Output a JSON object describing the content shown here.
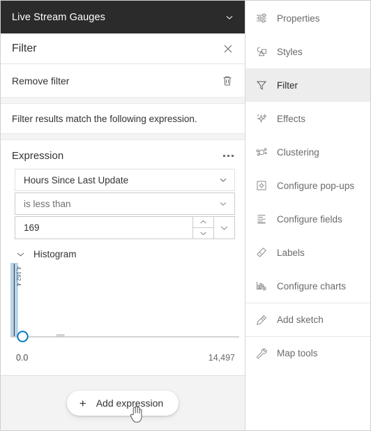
{
  "layer": {
    "title": "Live Stream Gauges",
    "collapse_icon": "chevron-down-icon"
  },
  "panel": {
    "title": "Filter",
    "close_icon": "close-icon",
    "remove_filter_label": "Remove filter",
    "remove_filter_icon": "trash-icon",
    "match_text": "Filter results match the following expression."
  },
  "expression": {
    "title": "Expression",
    "menu_icon": "kebab-menu-icon",
    "field_value": "Hours Since Last Update",
    "operator_value": "is less than",
    "number_value": "169",
    "caret_icon": "chevron-down-icon",
    "spinner_up_icon": "chevron-up-icon",
    "spinner_down_icon": "chevron-down-icon"
  },
  "histogram": {
    "label": "Histogram",
    "toggle_icon": "chevron-down-icon",
    "axis_min": "0.0",
    "axis_max": "14,497",
    "bar_value_label": "4,162.4",
    "handle_icon": "slider-handle"
  },
  "footer": {
    "add_expression_label": "Add expression",
    "plus_icon": "plus-icon",
    "cursor_icon": "pointer-hand-cursor"
  },
  "sidebar": {
    "items": [
      {
        "label": "Properties",
        "icon": "sliders-icon",
        "active": false,
        "divider_above": false
      },
      {
        "label": "Styles",
        "icon": "shapes-icon",
        "active": false,
        "divider_above": false
      },
      {
        "label": "Filter",
        "icon": "funnel-icon",
        "active": true,
        "divider_above": false
      },
      {
        "label": "Effects",
        "icon": "sparkles-icon",
        "active": false,
        "divider_above": false
      },
      {
        "label": "Clustering",
        "icon": "clustering-icon",
        "active": false,
        "divider_above": false
      },
      {
        "label": "Configure pop-ups",
        "icon": "popup-icon",
        "active": false,
        "divider_above": false
      },
      {
        "label": "Configure fields",
        "icon": "fields-list-icon",
        "active": false,
        "divider_above": false
      },
      {
        "label": "Labels",
        "icon": "label-tag-icon",
        "active": false,
        "divider_above": false
      },
      {
        "label": "Configure charts",
        "icon": "bar-chart-gear-icon",
        "active": false,
        "divider_above": false
      },
      {
        "label": "Add sketch",
        "icon": "pencil-sketch-icon",
        "active": false,
        "divider_above": true
      },
      {
        "label": "Map tools",
        "icon": "wrench-icon",
        "active": false,
        "divider_above": true
      }
    ]
  },
  "chart_data": {
    "type": "bar",
    "title": "Histogram",
    "xlabel": "",
    "ylabel": "",
    "xlim": [
      0,
      14497
    ],
    "bin_count": 20,
    "bins": [
      0,
      724.85,
      1449.7,
      2174.55,
      2899.4,
      3624.25,
      4349.1,
      5073.95,
      5798.8,
      6523.65,
      7248.5,
      7973.35,
      8698.2,
      9423.05,
      10147.9,
      10872.75,
      11597.6,
      12322.45,
      13047.3,
      13772.15
    ],
    "values": [
      4162.4,
      0,
      0,
      12,
      0,
      0,
      0,
      0,
      0,
      0,
      0,
      0,
      0,
      0,
      0,
      0,
      0,
      0,
      0,
      0
    ],
    "max_value": 4162.4,
    "bar_color": "#b7d5ea",
    "tick_labels": [
      "0.0",
      "14,497"
    ],
    "slider_handle_position": 0,
    "threshold_value": 169,
    "grid": false,
    "legend": null
  },
  "colors": {
    "header_bg": "#2b2b2b",
    "accent_blue": "#0079c1",
    "bar_fill": "#b7d5ea",
    "panel_bg": "#ffffff",
    "footer_bg": "#f3f3f3",
    "active_item_bg": "#ededed"
  }
}
